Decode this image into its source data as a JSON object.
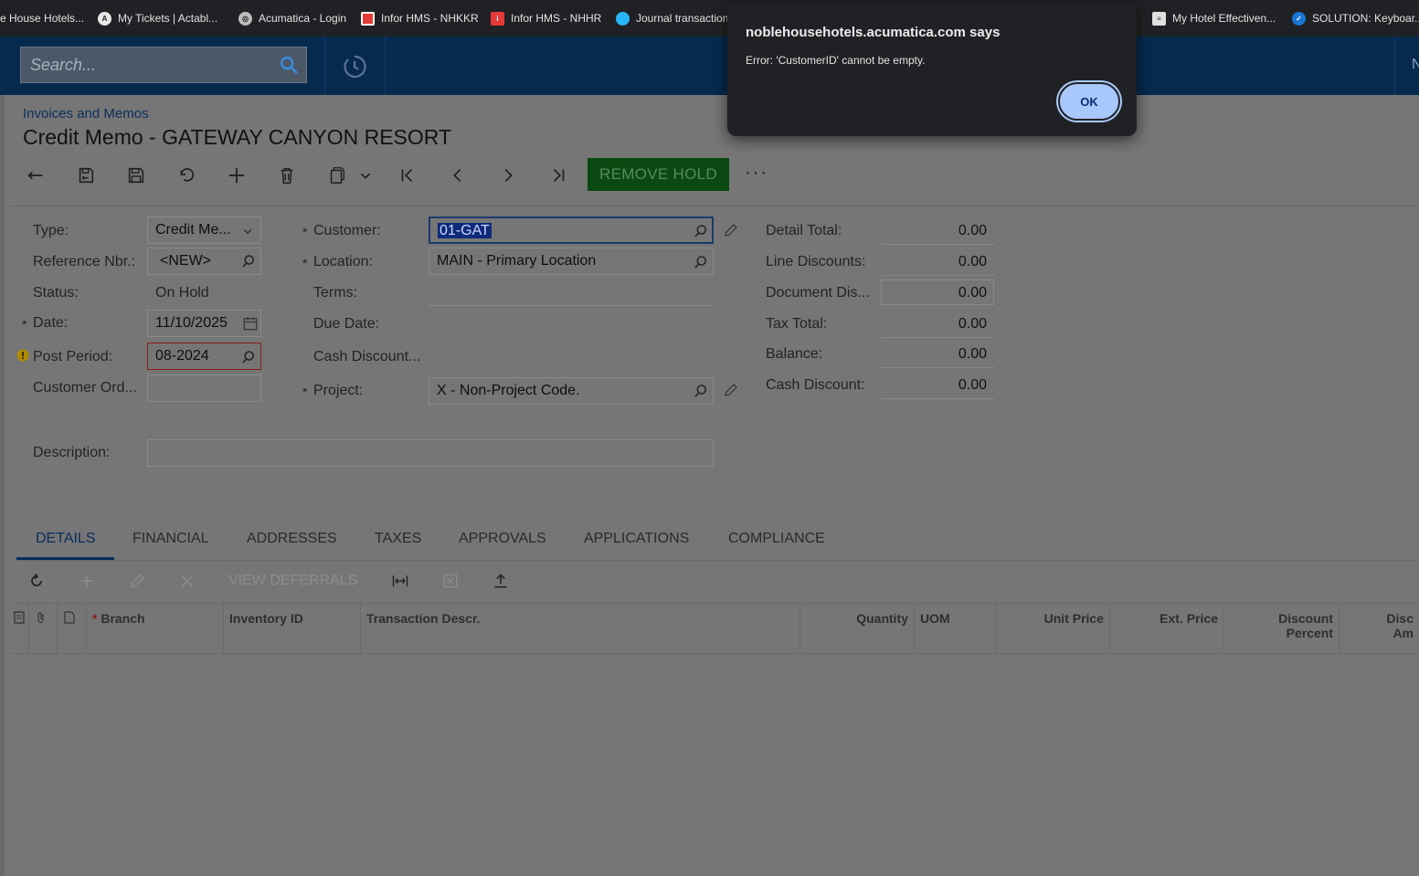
{
  "bookmarks": [
    {
      "label": "e House Hotels...",
      "icon": "none"
    },
    {
      "label": "My Tickets | Actabl...",
      "icon": "actabl-icon"
    },
    {
      "label": "Acumatica - Login",
      "icon": "globe-icon"
    },
    {
      "label": "Infor HMS - NHKKR",
      "icon": "infor-icon"
    },
    {
      "label": "Infor HMS - NHHR",
      "icon": "infor-icon"
    },
    {
      "label": "Journal transaction",
      "icon": "drop-icon"
    },
    {
      "label": "My Hotel Effectiven...",
      "icon": "doc-icon"
    },
    {
      "label": "SOLUTION: Keyboar...",
      "icon": "check-icon"
    }
  ],
  "header": {
    "search_placeholder": "Search...",
    "edge_letter": "N"
  },
  "breadcrumb": "Invoices and Memos",
  "title": "Credit Memo - GATEWAY CANYON RESORT",
  "toolbar": {
    "remove_hold": "REMOVE HOLD",
    "more": "···"
  },
  "form": {
    "type_label": "Type:",
    "type_value": "Credit Me...",
    "refnbr_label": "Reference Nbr.:",
    "refnbr_value": "<NEW>",
    "status_label": "Status:",
    "status_value": "On Hold",
    "date_label": "Date:",
    "date_value": "11/10/2025",
    "postperiod_label": "Post Period:",
    "postperiod_value": "08-2024",
    "custord_label": "Customer Ord...",
    "customer_label": "Customer:",
    "customer_value": "01-GAT",
    "location_label": "Location:",
    "location_value": "MAIN - Primary Location",
    "terms_label": "Terms:",
    "duedate_label": "Due Date:",
    "cashdisc_label": "Cash Discount...",
    "project_label": "Project:",
    "project_value": "X - Non-Project Code.",
    "description_label": "Description:",
    "required_mark": "*"
  },
  "totals": {
    "detail_total_label": "Detail Total:",
    "detail_total": "0.00",
    "line_discounts_label": "Line Discounts:",
    "line_discounts": "0.00",
    "doc_discount_label": "Document Dis...",
    "doc_discount": "0.00",
    "tax_total_label": "Tax Total:",
    "tax_total": "0.00",
    "balance_label": "Balance:",
    "balance": "0.00",
    "cash_discount_label": "Cash Discount:",
    "cash_discount": "0.00"
  },
  "tabs": [
    "DETAILS",
    "FINANCIAL",
    "ADDRESSES",
    "TAXES",
    "APPROVALS",
    "APPLICATIONS",
    "COMPLIANCE"
  ],
  "grid_toolbar": {
    "view_deferrals": "VIEW DEFERRALS"
  },
  "grid_columns": {
    "branch": "Branch",
    "inventory_id": "Inventory ID",
    "transaction_descr": "Transaction Descr.",
    "quantity": "Quantity",
    "uom": "UOM",
    "unit_price": "Unit Price",
    "ext_price": "Ext. Price",
    "discount_percent_1": "Discount",
    "discount_percent_2": "Percent",
    "disc_amt_1": "Disc",
    "disc_amt_2": "Am"
  },
  "dialog": {
    "title": "noblehousehotels.acumatica.com says",
    "message": "Error: 'CustomerID' cannot be empty.",
    "ok": "OK"
  },
  "colors": {
    "appbar": "#062a4e",
    "remove_hold_bg": "#0a4a12",
    "dialog_bg": "#202124",
    "ok_button": "#a8c7fa",
    "accent": "#062e5e"
  }
}
